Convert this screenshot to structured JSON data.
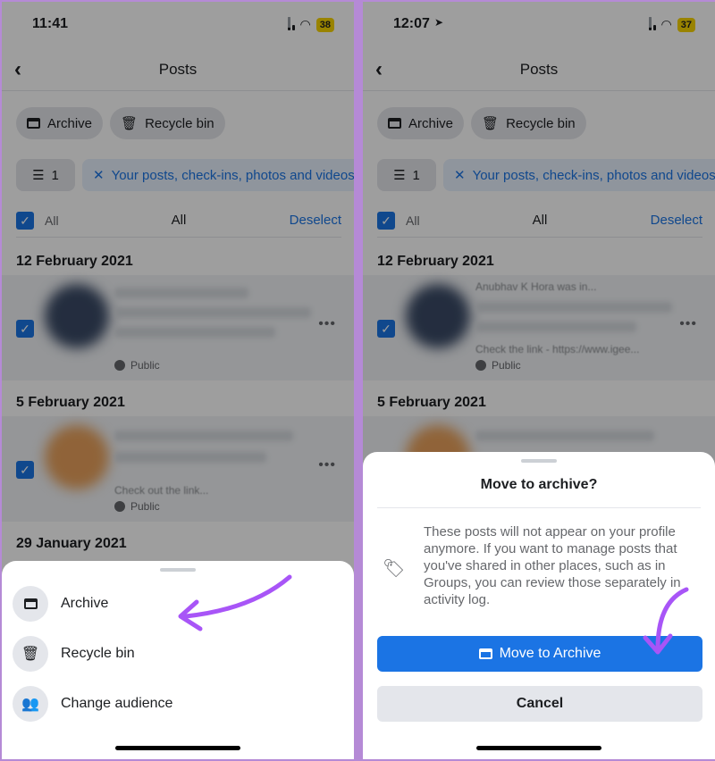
{
  "left": {
    "status": {
      "time": "11:41",
      "battery": "38"
    },
    "header": {
      "title": "Posts"
    },
    "chips": {
      "archive": "Archive",
      "recycle": "Recycle bin"
    },
    "filter": {
      "count": "1",
      "label": "Your posts, check-ins, photos and videos"
    },
    "select": {
      "all_label": "All",
      "center_label": "All",
      "deselect": "Deselect"
    },
    "dates": [
      "12 February 2021",
      "5 February 2021",
      "29 January 2021"
    ],
    "posts": [
      {
        "audience": "Public",
        "line1": "",
        "line2": ""
      },
      {
        "audience": "Public",
        "line1": "",
        "line2": "Check out the link..."
      }
    ],
    "sheet": {
      "items": [
        {
          "label": "Archive",
          "icon": "archive-icon"
        },
        {
          "label": "Recycle bin",
          "icon": "trash-icon"
        },
        {
          "label": "Change audience",
          "icon": "people-icon"
        }
      ]
    }
  },
  "right": {
    "status": {
      "time": "12:07",
      "battery": "37"
    },
    "header": {
      "title": "Posts"
    },
    "chips": {
      "archive": "Archive",
      "recycle": "Recycle bin"
    },
    "filter": {
      "count": "1",
      "label": "Your posts, check-ins, photos and videos"
    },
    "select": {
      "all_label": "All",
      "center_label": "All",
      "deselect": "Deselect"
    },
    "dates": [
      "12 February 2021",
      "5 February 2021"
    ],
    "posts": [
      {
        "audience": "Public",
        "line1": "Anubhav K Hora was in...",
        "line2": "Check the link - https://www.igee..."
      }
    ],
    "dialog": {
      "title": "Move to archive?",
      "body": "These posts will not appear on your profile anymore. If you want to manage posts that you've shared in other places, such as in Groups, you can review those separately in activity log.",
      "primary": "Move to Archive",
      "secondary": "Cancel"
    }
  },
  "colors": {
    "accent": "#1b74e4",
    "annotation_arrow": "#a855f7",
    "frame": "#b58ad6"
  }
}
